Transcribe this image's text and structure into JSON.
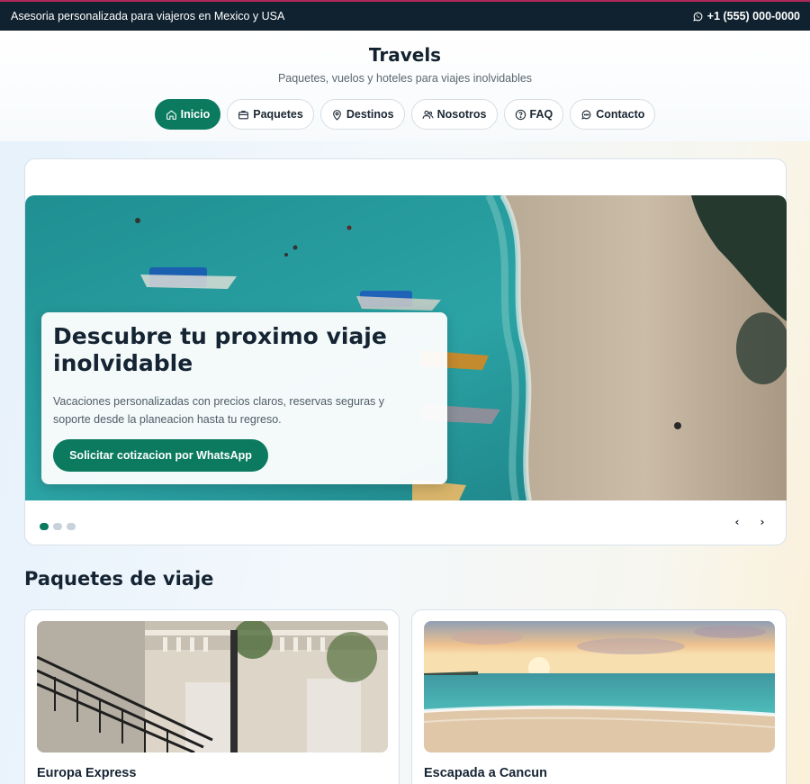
{
  "topbar": {
    "tagline": "Asesoria personalizada para viajeros en Mexico y USA",
    "phone": "+1 (555) 000-0000",
    "phone_icon": "whatsapp-icon"
  },
  "header": {
    "brand": "Travels",
    "subtitle": "Paquetes, vuelos y hoteles para viajes inolvidables"
  },
  "nav": {
    "items": [
      {
        "label": "Inicio",
        "icon": "home-icon",
        "active": true
      },
      {
        "label": "Paquetes",
        "icon": "briefcase-icon",
        "active": false
      },
      {
        "label": "Destinos",
        "icon": "map-pin-icon",
        "active": false
      },
      {
        "label": "Nosotros",
        "icon": "users-icon",
        "active": false
      },
      {
        "label": "FAQ",
        "icon": "help-circle-icon",
        "active": false
      },
      {
        "label": "Contacto",
        "icon": "chat-icon",
        "active": false
      }
    ]
  },
  "hero": {
    "title": "Descubre tu proximo viaje inolvidable",
    "text": "Vacaciones personalizadas con precios claros, reservas seguras y soporte desde la planeacion hasta tu regreso.",
    "button": "Solicitar cotizacion por WhatsApp",
    "slides_total": 3,
    "active_slide": 1,
    "prev_label": "‹",
    "next_label": "›"
  },
  "packages": {
    "title": "Paquetes de viaje",
    "items": [
      {
        "name": "Europa Express"
      },
      {
        "name": "Escapada a Cancun"
      }
    ]
  },
  "colors": {
    "accent": "#0b7a5f",
    "topbar": "#10222f",
    "topbar_border": "#b0285a"
  }
}
